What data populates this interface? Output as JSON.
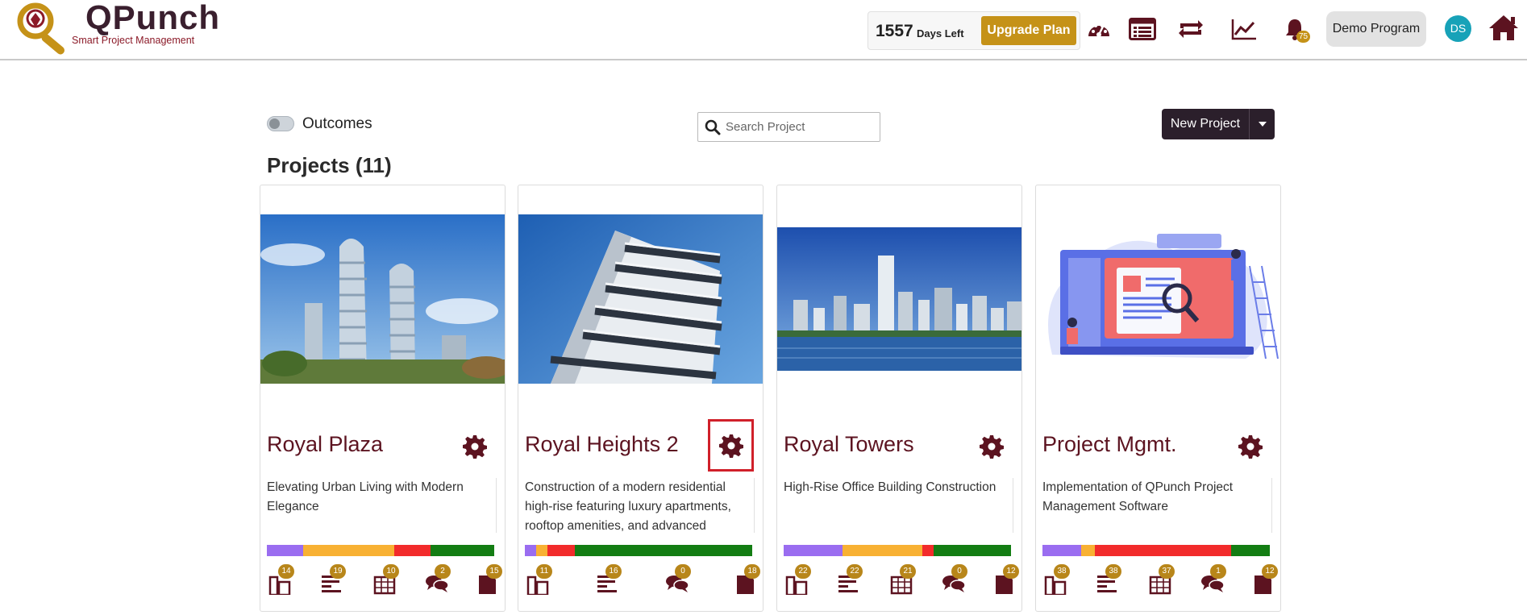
{
  "header": {
    "logo_title": "QPunch",
    "logo_subtitle": "Smart Project Management",
    "days_left_number": "1557",
    "days_left_label": "Days Left",
    "upgrade_label": "Upgrade Plan",
    "notification_count": "75",
    "program_label": "Demo Program",
    "avatar_initials": "DS"
  },
  "toolbar": {
    "outcomes_label": "Outcomes",
    "outcomes_on": false,
    "search_placeholder": "Search Project",
    "new_project_label": "New Project"
  },
  "projects_title": "Projects (11)",
  "colors": {
    "brand_maroon": "#5c1320",
    "gold": "#c59218",
    "purple": "#9a6df0",
    "orange": "#f8b133",
    "red": "#f22b2b",
    "green": "#137d13"
  },
  "projects": [
    {
      "name": "Royal Plaza",
      "description": "Elevating Urban Living with Modern Elegance",
      "image": "twisting-towers-photo",
      "progress": [
        0.16,
        0.4,
        0.16,
        0.28
      ],
      "counts": [
        "14",
        "19",
        "10",
        "2",
        "15"
      ]
    },
    {
      "name": "Royal Heights 2",
      "description": "Construction of a modern residential high-rise featuring luxury apartments, rooftop amenities, and advanced",
      "image": "highrise-balconies-photo",
      "progress": [
        0.05,
        0.05,
        0.12,
        0.78
      ],
      "counts": [
        "11",
        "16",
        "0",
        "18"
      ],
      "selected_settings": true
    },
    {
      "name": "Royal Towers",
      "description": "High-Rise Office Building Construction",
      "image": "city-skyline-photo",
      "progress": [
        0.26,
        0.35,
        0.05,
        0.34
      ],
      "counts": [
        "22",
        "22",
        "21",
        "0",
        "12"
      ]
    },
    {
      "name": "Project Mgmt.",
      "description": "Implementation of QPunch Project Management Software",
      "image": "project-management-illustration",
      "progress": [
        0.17,
        0.06,
        0.6,
        0.17
      ],
      "counts": [
        "38",
        "38",
        "37",
        "1",
        "12"
      ]
    }
  ]
}
